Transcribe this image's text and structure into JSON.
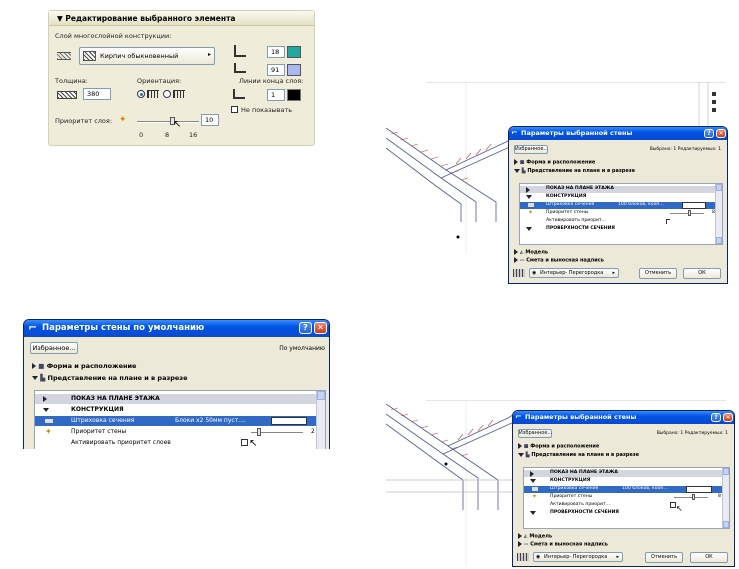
{
  "edit_panel": {
    "header": "Редактирование выбранного элемента",
    "layer_label": "Слой многослойной конструкции:",
    "material": "Кирпич обыкновенный",
    "pen1": "18",
    "pen2": "91",
    "thickness_label": "Толщина:",
    "thickness_value": "380",
    "orientation_label": "Ориентация:",
    "end_lines_label": "Линии конца слоя:",
    "end_line_value": "1",
    "hide_label": "Не показывать",
    "priority_label": "Приоритет слоя:",
    "priority_value": "10",
    "ticks": [
      "0",
      "8",
      "16"
    ]
  },
  "default_dialog": {
    "title": "Параметры стены по умолчанию",
    "favorites": "Избранное...",
    "mode": "По умолчанию",
    "sec1": "Форма и расположение",
    "sec2": "Представление на плане и в разрезе",
    "rows": {
      "floor_plan": "ПОКАЗ НА ПЛАНЕ ЭТАЖА",
      "construction": "КОНСТРУКЦИЯ",
      "hatch": "Штриховка сечения",
      "hatch_value": "Блоки x2  50мм пуст....",
      "priority": "Приоритет стены",
      "priority_value": "2",
      "activate": "Активировать приоритет слоев"
    }
  },
  "selected_dialog_top": {
    "title": "Параметры выбранной стены",
    "favorites": "Избранное...",
    "selected_info": "Выбрано: 1 Редактируемых: 1",
    "sec1": "Форма и расположение",
    "sec2": "Представление на плане и в разрезе",
    "rows": {
      "floor_plan": "ПОКАЗ НА ПЛАНЕ ЭТАЖА",
      "construction": "КОНСТРУКЦИЯ",
      "hatch": "Штриховка сечения",
      "hatch_value": "100 блоков, кооп...",
      "priority": "Приоритет стены",
      "priority_value": "8",
      "activate": "Активировать приорит...",
      "section": "ПРОВЕРХНОСТИ СЕЧЕНИЯ"
    },
    "sec3": "Модель",
    "sec4": "Смета и выносная надпись",
    "layer_select": "Интерьер- Перегородка",
    "cancel": "Отменить",
    "ok": "ОК"
  },
  "selected_dialog_bottom": {
    "title": "Параметры выбранной стены",
    "favorites": "Избранное...",
    "selected_info": "Выбрано: 1 Редактируемых: 1",
    "sec1": "Форма и расположение",
    "sec2": "Представление на плане и в разрезе",
    "rows": {
      "floor_plan": "ПОКАЗ НА ПЛАНЕ ЭТАЖА",
      "construction": "КОНСТРУКЦИЯ",
      "hatch": "Штриховка сечения",
      "hatch_value": "100 блоков, кооп...",
      "priority": "Приоритет стены",
      "priority_value": "8",
      "activate": "Активировать приорит...",
      "section": "ПРОВЕРХНОСТИ СЕЧЕНИЯ"
    },
    "sec3": "Модель",
    "sec4": "Смета и выносная надпись",
    "layer_select": "Интерьер- Перегородка",
    "cancel": "Отменить",
    "ok": "ОК"
  },
  "colors": {
    "xp_title": "#0054e3",
    "selection": "#316ac5",
    "panel_bg": "#efedda",
    "wall_line": "#4a5a9a",
    "hatch_red": "#d04040"
  },
  "icons": [
    "help-icon",
    "close-icon",
    "shape-icon",
    "plan-section-icon",
    "hatch-icon",
    "priority-icon",
    "model-icon",
    "listing-icon",
    "layer-icon"
  ]
}
